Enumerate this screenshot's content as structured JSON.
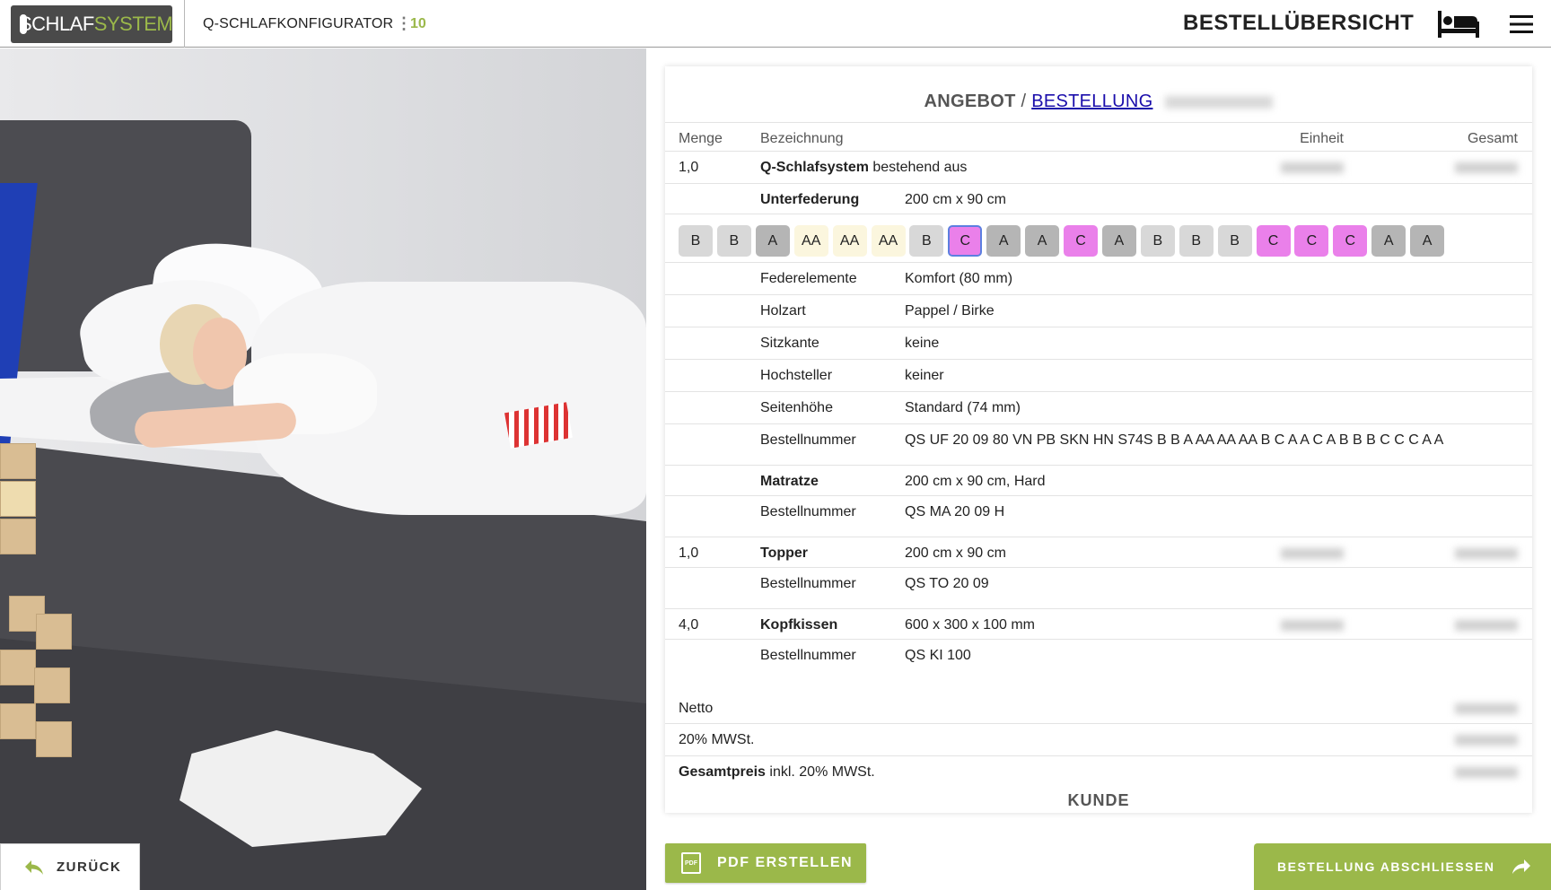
{
  "header": {
    "logo_text_left": "SCHLAF",
    "logo_text_right": "SYSTEM",
    "logo_letter": "Q",
    "app_title": "Q-SCHLAFKONFIGURATOR",
    "more_glyph": "⋮",
    "count": "10",
    "page_title": "BESTELLÜBERSICHT"
  },
  "icons": {
    "bed": "bed-icon",
    "menu": "menu-icon",
    "back": "reply-arrow-icon",
    "forward": "share-arrow-icon",
    "pdf": "pdf-file-icon"
  },
  "back_button": {
    "label": "ZURÜCK"
  },
  "order": {
    "title_offer": "ANGEBOT",
    "title_sep": " / ",
    "title_link": "BESTELLUNG",
    "columns": {
      "menge": "Menge",
      "bezeichnung": "Bezeichnung",
      "einheit": "Einheit",
      "gesamt": "Gesamt"
    },
    "system": {
      "menge": "1,0",
      "name": "Q-Schlafsystem",
      "suffix": " bestehend aus"
    },
    "unterfederung": {
      "label": "Unterfederung",
      "value": "200 cm x 90 cm"
    },
    "zones": [
      "B",
      "B",
      "A",
      "AA",
      "AA",
      "AA",
      "B",
      "C",
      "A",
      "A",
      "C",
      "A",
      "B",
      "B",
      "B",
      "C",
      "C",
      "C",
      "A",
      "A"
    ],
    "selected_zone_index": 7,
    "zone_colors": {
      "A": "#b5b5b5",
      "B": "#d8d8d8",
      "AA": "#fbf6de",
      "C": "#ea80ea"
    },
    "details": [
      {
        "label": "Federelemente",
        "value": "Komfort (80 mm)"
      },
      {
        "label": "Holzart",
        "value": "Pappel / Birke"
      },
      {
        "label": "Sitzkante",
        "value": "keine"
      },
      {
        "label": "Hochsteller",
        "value": "keiner"
      },
      {
        "label": "Seitenhöhe",
        "value": "Standard (74 mm)"
      },
      {
        "label": "Bestellnummer",
        "value": "QS UF 20 09 80 VN PB SKN HN S74S B B A AA AA AA B C A A C A B B B C C C A A"
      }
    ],
    "matratze": {
      "label": "Matratze",
      "value": "200 cm x 90 cm, Hard",
      "order_label": "Bestellnummer",
      "order_value": "QS MA 20 09 H"
    },
    "topper": {
      "menge": "1,0",
      "label": "Topper",
      "value": "200 cm x 90 cm",
      "order_label": "Bestellnummer",
      "order_value": "QS TO 20 09"
    },
    "kopfkissen": {
      "menge": "4,0",
      "label": "Kopfkissen",
      "value": "600 x 300 x 100 mm",
      "order_label": "Bestellnummer",
      "order_value": "QS KI 100"
    },
    "totals": {
      "netto": "Netto",
      "mwst": "20% MWSt.",
      "gesamt_bold": "Gesamtpreis",
      "gesamt_rest": " inkl. 20% MWSt."
    },
    "kunde_heading": "KUNDE"
  },
  "buttons": {
    "pdf": "PDF ERSTELLEN",
    "pdf_icon_text": "PDF",
    "finish": "BESTELLUNG ABSCHLIESSEN"
  },
  "colors": {
    "accent": "#9bb84a",
    "link": "#1a0dab",
    "selected_border": "#5d7fe0"
  }
}
